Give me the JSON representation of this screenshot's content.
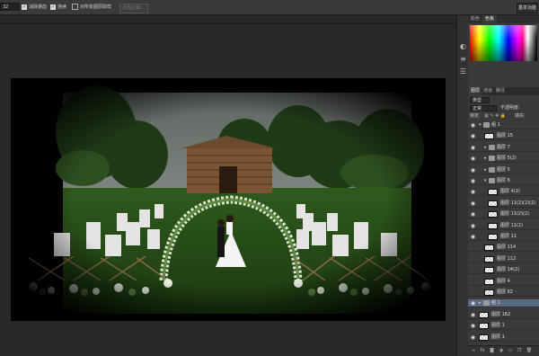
{
  "options_bar": {
    "size_value": "32",
    "checkbox_antialias": "消除锯齿",
    "checkbox_contiguous": "连续",
    "checkbox_all_layers": "对所有图层取样",
    "refine_edge_button": "调整边缘...",
    "workspace_button": "基本功能"
  },
  "panel_top": {
    "tab_color": "颜色",
    "tab_swatches": "色板"
  },
  "layers_panel": {
    "tab_layers": "图层",
    "tab_channels": "通道",
    "tab_paths": "路径",
    "kind_filter": "类型",
    "blend_mode": "正常",
    "opacity_label": "不透明度:",
    "lock_label": "锁定:",
    "fill_label": "填充:",
    "layers": [
      {
        "name": "组 1",
        "type": "group",
        "open": true,
        "visible": true
      },
      {
        "name": "图层 15",
        "type": "layer",
        "visible": true
      },
      {
        "name": "图层 7",
        "type": "group",
        "open": false,
        "visible": true
      },
      {
        "name": "图层 5(2)",
        "type": "group",
        "open": false,
        "visible": true
      },
      {
        "name": "图层 5",
        "type": "group",
        "open": false,
        "visible": true
      },
      {
        "name": "图层 6",
        "type": "group",
        "open": true,
        "visible": true
      },
      {
        "name": "图层 4(2)",
        "type": "layer",
        "visible": true
      },
      {
        "name": "图层 11(2)(2)(2)",
        "type": "layer",
        "visible": true
      },
      {
        "name": "图层 11(2)(2)",
        "type": "layer",
        "visible": true
      },
      {
        "name": "图层 11(2)",
        "type": "layer",
        "visible": true
      },
      {
        "name": "图层 11",
        "type": "layer",
        "visible": true
      },
      {
        "name": "图层 114",
        "type": "layer",
        "visible": false
      },
      {
        "name": "图层 112",
        "type": "layer",
        "visible": false
      },
      {
        "name": "图层 14(2)",
        "type": "layer",
        "visible": false
      },
      {
        "name": "图层 4",
        "type": "layer",
        "visible": false
      },
      {
        "name": "图层 62",
        "type": "layer",
        "visible": false
      },
      {
        "name": "组 1",
        "type": "group",
        "open": false,
        "visible": true,
        "selected": true
      },
      {
        "name": "图层 162",
        "type": "layer",
        "visible": true
      },
      {
        "name": "图层 1",
        "type": "layer",
        "visible": true
      },
      {
        "name": "图层 1",
        "type": "layer",
        "visible": true
      }
    ]
  }
}
